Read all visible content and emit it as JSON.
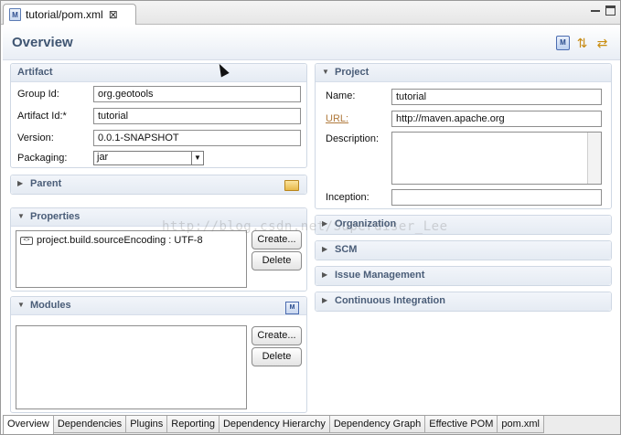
{
  "editor_tab": {
    "icon": "maven-pom-icon",
    "icon_text": "M",
    "title": "tutorial/pom.xml",
    "close": "⊠"
  },
  "header": {
    "title": "Overview",
    "pom_icon_text": "M"
  },
  "artifact": {
    "title": "Artifact",
    "group_id_label": "Group Id:",
    "group_id": "org.geotools",
    "artifact_id_label": "Artifact Id:*",
    "artifact_id": "tutorial",
    "version_label": "Version:",
    "version": "0.0.1-SNAPSHOT",
    "packaging_label": "Packaging:",
    "packaging": "jar"
  },
  "parent": {
    "title": "Parent"
  },
  "properties": {
    "title": "Properties",
    "items": [
      {
        "text": "project.build.sourceEncoding : UTF-8",
        "icon_text": "<>"
      }
    ],
    "create_label": "Create...",
    "delete_label": "Delete"
  },
  "modules": {
    "title": "Modules",
    "create_label": "Create...",
    "delete_label": "Delete"
  },
  "project": {
    "title": "Project",
    "name_label": "Name:",
    "name": "tutorial",
    "url_label": "URL:",
    "url": "http://maven.apache.org",
    "description_label": "Description:",
    "inception_label": "Inception:"
  },
  "collapsed_sections": {
    "organization": "Organization",
    "scm": "SCM",
    "issue_management": "Issue Management",
    "continuous_integration": "Continuous Integration"
  },
  "bottom_tabs": [
    "Overview",
    "Dependencies",
    "Plugins",
    "Reporting",
    "Dependency Hierarchy",
    "Dependency Graph",
    "Effective POM",
    "pom.xml"
  ],
  "watermark": "http://blog.csdn.net/Superdiser_Lee",
  "colors": {
    "header_title": "#3f5572",
    "section_title": "#4a5d78",
    "url_link": "#b07a3c"
  }
}
